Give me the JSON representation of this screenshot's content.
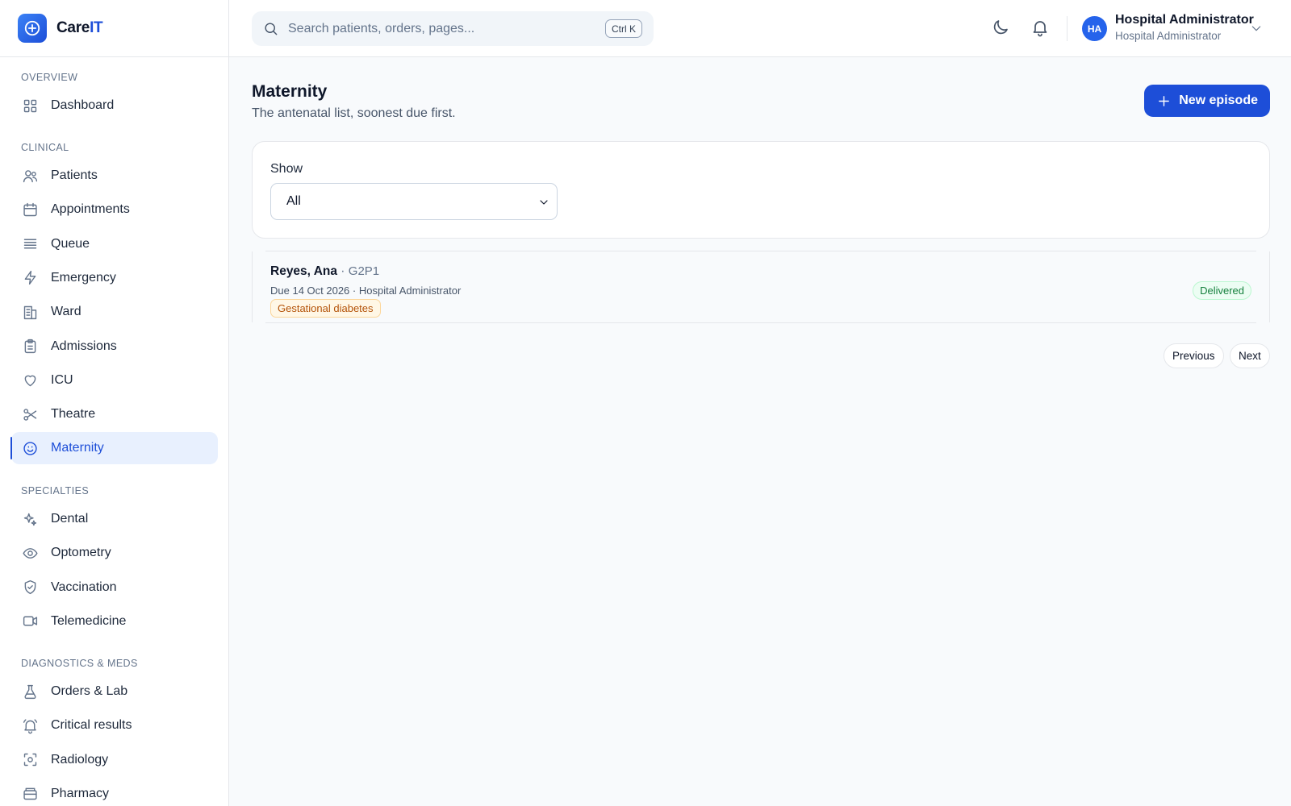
{
  "brand": {
    "name_part1": "Care",
    "name_part2": "IT",
    "accent_color": "#1d4ed8"
  },
  "sidebar": {
    "sections": [
      {
        "label": "OVERVIEW",
        "items": [
          {
            "label": "Dashboard",
            "icon": "grid-icon"
          }
        ]
      },
      {
        "label": "CLINICAL",
        "items": [
          {
            "label": "Patients",
            "icon": "users-icon"
          },
          {
            "label": "Appointments",
            "icon": "calendar-icon"
          },
          {
            "label": "Queue",
            "icon": "list-icon"
          },
          {
            "label": "Emergency",
            "icon": "zap-icon"
          },
          {
            "label": "Ward",
            "icon": "building-icon"
          },
          {
            "label": "Admissions",
            "icon": "clipboard-icon"
          },
          {
            "label": "ICU",
            "icon": "heart-icon"
          },
          {
            "label": "Theatre",
            "icon": "scissors-icon"
          },
          {
            "label": "Maternity",
            "icon": "smile-icon",
            "active": true
          }
        ]
      },
      {
        "label": "SPECIALTIES",
        "items": [
          {
            "label": "Dental",
            "icon": "sparkles-icon"
          },
          {
            "label": "Optometry",
            "icon": "eye-icon"
          },
          {
            "label": "Vaccination",
            "icon": "shield-check-icon"
          },
          {
            "label": "Telemedicine",
            "icon": "video-icon"
          }
        ]
      },
      {
        "label": "DIAGNOSTICS & MEDS",
        "items": [
          {
            "label": "Orders & Lab",
            "icon": "flask-icon"
          },
          {
            "label": "Critical results",
            "icon": "bell-ring-icon"
          },
          {
            "label": "Radiology",
            "icon": "scan-icon"
          },
          {
            "label": "Pharmacy",
            "icon": "pill-box-icon"
          }
        ]
      }
    ]
  },
  "header": {
    "search_placeholder": "Search patients, orders, pages...",
    "search_shortcut": "Ctrl K",
    "user": {
      "initials": "HA",
      "name": "Hospital Administrator",
      "role": "Hospital Administrator"
    }
  },
  "main": {
    "title": "Maternity",
    "subtitle": "The antenatal list, soonest due first.",
    "new_button_label": "New episode",
    "filter": {
      "label": "Show",
      "selected": "All"
    },
    "episodes": [
      {
        "name": "Reyes, Ana",
        "separator": " · ",
        "gravida_para": "G2P1",
        "meta": "Due 14 Oct 2026 · Hospital Administrator",
        "tag": "Gestational diabetes",
        "status": "Delivered"
      }
    ],
    "pagination": {
      "previous_label": "Previous",
      "next_label": "Next"
    }
  }
}
